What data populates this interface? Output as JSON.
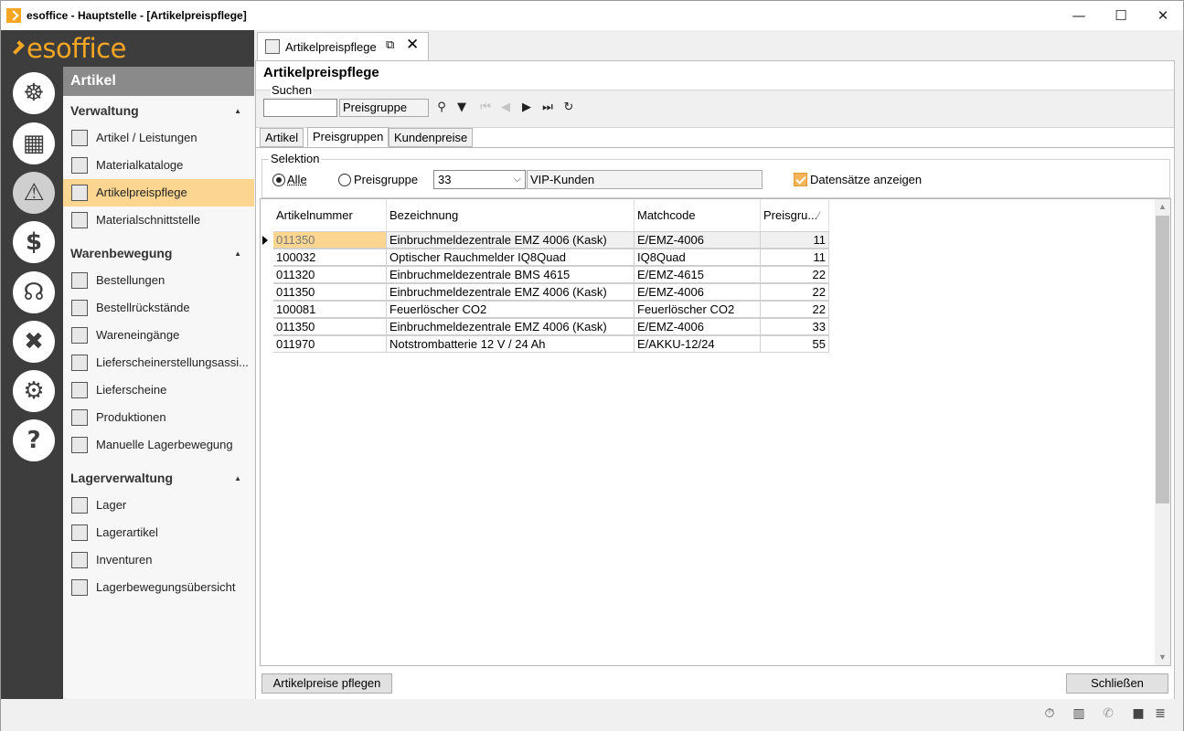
{
  "window": {
    "title": "esoffice - Hauptstelle - [Artikelpreispflege]",
    "controls": [
      "minimize",
      "maximize",
      "close"
    ]
  },
  "logo": "esoffice",
  "rail": [
    {
      "name": "helm-icon",
      "glyph": "☸"
    },
    {
      "name": "calendar-icon",
      "glyph": "▦"
    },
    {
      "name": "alarm-light-icon",
      "glyph": "⚠"
    },
    {
      "name": "money-icon",
      "glyph": "$"
    },
    {
      "name": "headset-icon",
      "glyph": "☊"
    },
    {
      "name": "tools-icon",
      "glyph": "✖"
    },
    {
      "name": "gears-icon",
      "glyph": "⚙"
    },
    {
      "name": "help-icon",
      "glyph": "?"
    }
  ],
  "nav": {
    "header": "Artikel",
    "sections": [
      {
        "label": "Verwaltung",
        "items": [
          "Artikel / Leistungen",
          "Materialkataloge",
          "Artikelpreispflege",
          "Materialschnittstelle"
        ]
      },
      {
        "label": "Warenbewegung",
        "items": [
          "Bestellungen",
          "Bestellrückstände",
          "Wareneingänge",
          "Lieferscheinerstellungsassi...",
          "Lieferscheine",
          "Produktionen",
          "Manuelle Lagerbewegung"
        ]
      },
      {
        "label": "Lagerverwaltung",
        "items": [
          "Lager",
          "Lagerartikel",
          "Inventuren",
          "Lagerbewegungsübersicht"
        ]
      }
    ],
    "selected": "Artikelpreispflege"
  },
  "doc_tab": {
    "label": "Artikelpreispflege"
  },
  "page_title": "Artikelpreispflege",
  "search": {
    "legend": "Suchen",
    "value": "",
    "field": "Preisgruppe"
  },
  "tabs": [
    "Artikel",
    "Preisgruppen",
    "Kundenpreise"
  ],
  "active_tab": "Preisgruppen",
  "selektion": {
    "legend": "Selektion",
    "option_all": "Alle",
    "option_group": "Preisgruppe",
    "selected": "Alle",
    "group_value": "33",
    "group_name": "VIP-Kunden",
    "show_records_label": "Datensätze anzeigen",
    "show_records_checked": true
  },
  "grid": {
    "columns": [
      "Artikelnummer",
      "Bezeichnung",
      "Matchcode",
      "Preisgru..."
    ],
    "rows": [
      [
        "011350",
        "Einbruchmeldezentrale EMZ 4006 (Kask)",
        "E/EMZ-4006",
        "11"
      ],
      [
        "100032",
        "Optischer Rauchmelder IQ8Quad",
        "IQ8Quad",
        "11"
      ],
      [
        "011320",
        "Einbruchmeldezentrale BMS 4615",
        "E/EMZ-4615",
        "22"
      ],
      [
        "011350",
        "Einbruchmeldezentrale EMZ 4006 (Kask)",
        "E/EMZ-4006",
        "22"
      ],
      [
        "100081",
        "Feuerlöscher CO2",
        "Feuerlöscher CO2",
        "22"
      ],
      [
        "011350",
        "Einbruchmeldezentrale EMZ 4006 (Kask)",
        "E/EMZ-4006",
        "33"
      ],
      [
        "011970",
        "Notstrombatterie 12 V / 24 Ah",
        "E/AKKU-12/24",
        "55"
      ]
    ],
    "current_row": 0
  },
  "buttons": {
    "maintain_prices": "Artikelpreise pflegen",
    "close": "Schließen"
  },
  "status_icons": [
    "stopwatch-icon",
    "building-icon",
    "phone-icon",
    "lock-icon",
    "database-icon"
  ],
  "colors": {
    "accent": "#f5a623",
    "selection": "#fcd690",
    "rail": "#3d3d3d"
  }
}
